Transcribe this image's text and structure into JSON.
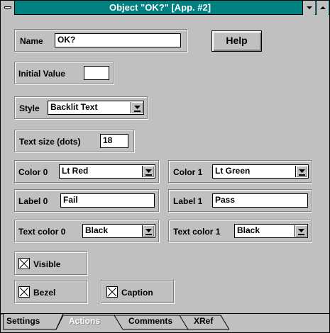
{
  "window": {
    "title": "Object \"OK?\" [App. #2]"
  },
  "name": {
    "label": "Name",
    "value": "OK?"
  },
  "help_button": "Help",
  "initial_value": {
    "label": "Initial Value",
    "value": ""
  },
  "style": {
    "label": "Style",
    "value": "Backlit Text"
  },
  "text_size": {
    "label": "Text size (dots)",
    "value": "18"
  },
  "color0": {
    "label": "Color 0",
    "value": "Lt Red"
  },
  "color1": {
    "label": "Color 1",
    "value": "Lt Green"
  },
  "label0": {
    "label": "Label 0",
    "value": "Fail"
  },
  "label1": {
    "label": "Label 1",
    "value": "Pass"
  },
  "text_color0": {
    "label": "Text color 0",
    "value": "Black"
  },
  "text_color1": {
    "label": "Text color 1",
    "value": "Black"
  },
  "visible": {
    "label": "Visible",
    "checked": true
  },
  "bezel": {
    "label": "Bezel",
    "checked": true
  },
  "caption": {
    "label": "Caption",
    "checked": true
  },
  "tabs": [
    {
      "label": "Settings",
      "active": true
    },
    {
      "label": "Actions",
      "enabled": false
    },
    {
      "label": "Comments"
    },
    {
      "label": "XRef"
    }
  ],
  "colors": {
    "titlebar": "#008080",
    "face": "#c0c0c0"
  }
}
